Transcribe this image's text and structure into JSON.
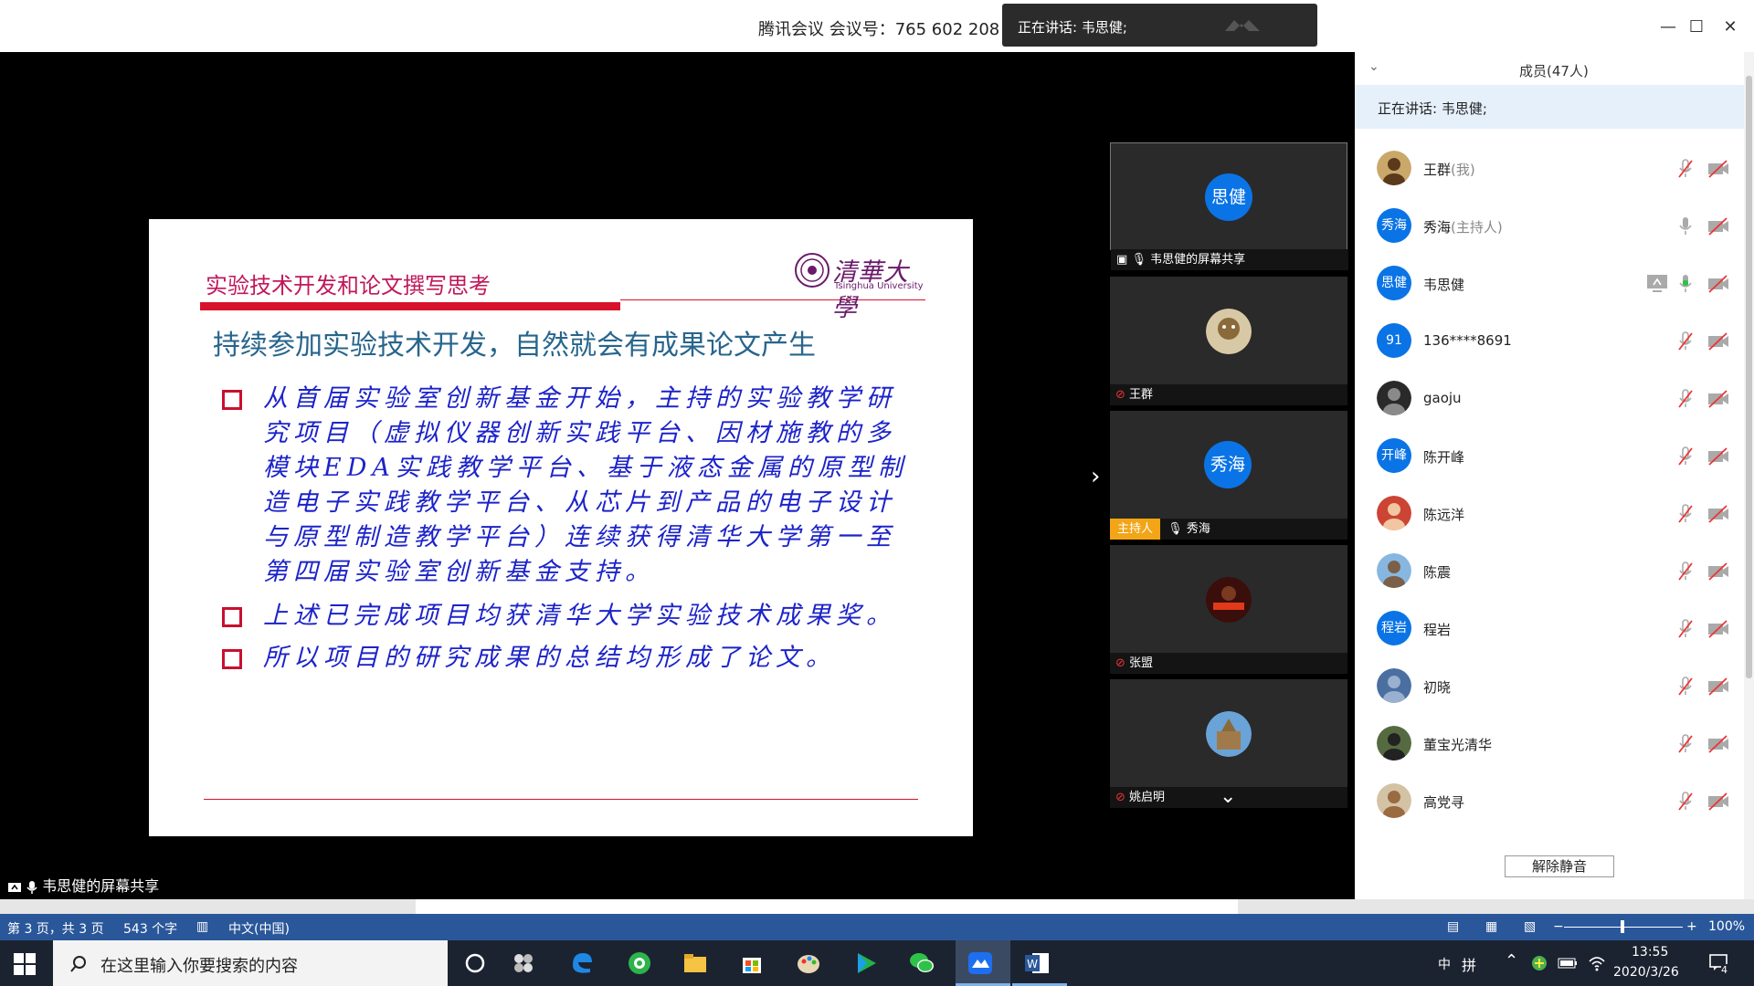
{
  "window": {
    "meeting_title": "腾讯会议 会议号：765 602 208",
    "speaking_toast": "正在讲话: 韦思健;",
    "minimize_label": "—",
    "maximize_label": "☐",
    "close_label": "✕"
  },
  "slide": {
    "heading": "实验技术开发和论文撰写思考",
    "logo_cn": "清華大學",
    "logo_en": "Tsinghua University",
    "subtitle": "持续参加实验技术开发，自然就会有成果论文产生",
    "bullets": [
      "从首届实验室创新基金开始，主持的实验教学研究项目（虚拟仪器创新实践平台、因材施教的多模块EDA实践教学平台、基于液态金属的原型制造电子实践教学平台、从芯片到产品的电子设计与原型制造教学平台）连续获得清华大学第一至第四届实验室创新基金支持。",
      "上述已完成项目均获清华大学实验技术成果奖。",
      "所以项目的研究成果的总结均形成了论文。"
    ]
  },
  "stage": {
    "share_label": "韦思健的屏幕共享",
    "next_arrow": "›"
  },
  "gallery": [
    {
      "name": "韦思健的屏幕共享",
      "avatar_text": "思健",
      "host_tag": ""
    },
    {
      "name": "王群",
      "avatar_text": "",
      "host_tag": ""
    },
    {
      "name": "秀海",
      "avatar_text": "秀海",
      "host_tag": "主持人"
    },
    {
      "name": "张盟",
      "avatar_text": "",
      "host_tag": ""
    },
    {
      "name": "姚启明",
      "avatar_text": "",
      "host_tag": ""
    }
  ],
  "gallery_more": "⌄",
  "panel": {
    "title": "成员(47人)",
    "collapse_label": "⌄",
    "speaking": "正在讲话: 韦思健;",
    "unmute_button": "解除静音",
    "members": [
      {
        "avatar_text": "",
        "name": "王群",
        "role": "(我)",
        "mic": "muted",
        "share": false
      },
      {
        "avatar_text": "秀海",
        "name": "秀海",
        "role": "(主持人)",
        "mic": "on",
        "share": false
      },
      {
        "avatar_text": "思健",
        "name": "韦思健",
        "role": "",
        "mic": "active",
        "share": true
      },
      {
        "avatar_text": "91",
        "name": "136****8691",
        "role": "",
        "mic": "muted",
        "share": false
      },
      {
        "avatar_text": "",
        "name": "gaoju",
        "role": "",
        "mic": "muted",
        "share": false
      },
      {
        "avatar_text": "开峰",
        "name": "陈开峰",
        "role": "",
        "mic": "muted",
        "share": false
      },
      {
        "avatar_text": "",
        "name": "陈远洋",
        "role": "",
        "mic": "muted",
        "share": false
      },
      {
        "avatar_text": "",
        "name": "陈震",
        "role": "",
        "mic": "muted",
        "share": false
      },
      {
        "avatar_text": "程岩",
        "name": "程岩",
        "role": "",
        "mic": "muted",
        "share": false
      },
      {
        "avatar_text": "",
        "name": "初晓",
        "role": "",
        "mic": "muted",
        "share": false
      },
      {
        "avatar_text": "",
        "name": "董宝光清华",
        "role": "",
        "mic": "muted",
        "share": false
      },
      {
        "avatar_text": "",
        "name": "高党寻",
        "role": "",
        "mic": "muted",
        "share": false
      }
    ]
  },
  "word_status": {
    "page": "第 3 页，共 3 页",
    "words": "543 个字",
    "language": "中文(中国)",
    "zoom": "100%",
    "zoom_minus": "−",
    "zoom_plus": "+"
  },
  "taskbar": {
    "search_placeholder": "在这里输入你要搜索的内容",
    "ime_lang": "中",
    "ime_mode": "拼",
    "time": "13:55",
    "date": "2020/3/26",
    "notification_count": "4"
  },
  "colors": {
    "tencent_blue": "#0a74e6",
    "slide_red": "#d8122b",
    "slide_blue_text": "#1c23c9",
    "host_orange": "#f2a516",
    "word_blue": "#2a579a"
  }
}
